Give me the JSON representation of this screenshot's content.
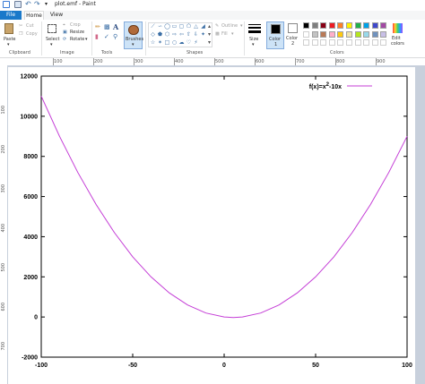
{
  "window": {
    "title": "plot.emf - Paint"
  },
  "tabs": {
    "file": "File",
    "home": "Home",
    "view": "View"
  },
  "clipboard": {
    "paste": "Paste",
    "cut": "Cut",
    "copy": "Copy",
    "group": "Clipboard"
  },
  "image": {
    "select": "Select",
    "crop": "Crop",
    "resize": "Resize",
    "rotate": "Rotate",
    "group": "Image"
  },
  "tools": {
    "group": "Tools",
    "text_tool": "A"
  },
  "brushes": {
    "label": "Brushes"
  },
  "shapes": {
    "outline": "Outline",
    "fill": "Fill",
    "group": "Shapes"
  },
  "size": {
    "label": "Size"
  },
  "colors": {
    "color1_label": "Color",
    "color1_num": "1",
    "color2_label": "Color",
    "color2_num": "2",
    "edit_label": "Edit",
    "edit_label2": "colors",
    "group": "Colors",
    "palette": [
      "#000000",
      "#7f7f7f",
      "#880015",
      "#ed1c24",
      "#ff7f27",
      "#fff200",
      "#22b14c",
      "#00a2e8",
      "#3f48cc",
      "#a349a4",
      "#ffffff",
      "#c3c3c3",
      "#b97a57",
      "#ffaec9",
      "#ffc90e",
      "#efe4b0",
      "#b5e61d",
      "#99d9ea",
      "#7092be",
      "#c8bfe7",
      "#ffffff",
      "#ffffff",
      "#ffffff",
      "#ffffff",
      "#ffffff",
      "#ffffff",
      "#ffffff",
      "#ffffff",
      "#ffffff",
      "#ffffff"
    ]
  },
  "ruler": {
    "h_ticks": [
      "100",
      "200",
      "300",
      "400",
      "500",
      "600",
      "700",
      "800",
      "900"
    ],
    "v_ticks": [
      "100",
      "200",
      "300",
      "400",
      "500",
      "600",
      "700"
    ]
  },
  "chart_data": {
    "type": "line",
    "legend_label": "f(x)=x",
    "legend_sup": "2",
    "legend_tail": "-10x",
    "legend_position": "top-right",
    "series_color": "#c43dd6",
    "function": "x^2-10x",
    "xlim": [
      -100,
      100
    ],
    "ylim": [
      -2000,
      12000
    ],
    "xticks": [
      "-100",
      "-50",
      "0",
      "50",
      "100"
    ],
    "yticks": [
      "-2000",
      "0",
      "2000",
      "4000",
      "6000",
      "8000",
      "10000",
      "12000"
    ],
    "x": [
      -100,
      -90,
      -80,
      -70,
      -60,
      -50,
      -40,
      -30,
      -20,
      -10,
      0,
      5,
      10,
      20,
      30,
      40,
      50,
      60,
      70,
      80,
      90,
      100
    ],
    "y": [
      11000,
      8999,
      7200,
      5600,
      4200,
      3000,
      2000,
      1200,
      600,
      200,
      0,
      -25,
      0,
      200,
      600,
      1200,
      2000,
      3000,
      4200,
      5600,
      7200,
      9000
    ]
  }
}
